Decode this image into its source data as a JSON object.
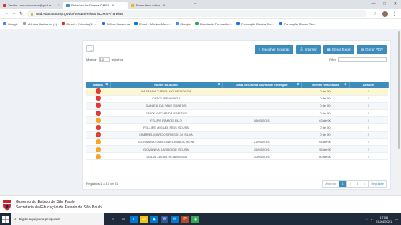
{
  "tabs": [
    {
      "label": "Tarefa - rosanasaraiva@prof.edu.com",
      "color": "#d93025",
      "active": false
    },
    {
      "label": "Relatório de Tarefas CMSP",
      "color": "#3c8dbc",
      "active": true
    },
    {
      "label": "Formulário editor",
      "color": "#f4b400",
      "active": false
    }
  ],
  "window_controls": [
    "—",
    "□",
    "✕"
  ],
  "address": {
    "url": "sed.educacao.sp.gov.br/SedBI/RelatorioCMSP/Tarefas"
  },
  "bookmarks": [
    {
      "label": "Google",
      "color": "#4285f4"
    },
    {
      "label": "Mônica Harikamp (1)",
      "color": "#9e9e9e"
    },
    {
      "label": "Gmail - Entrada (1) ...",
      "color": "#d93025"
    },
    {
      "label": "Sêltica Mostema",
      "color": "#1a73e8"
    },
    {
      "label": "Email - Mônica Maru...",
      "color": "#0078d4"
    },
    {
      "label": "Google",
      "color": "#4285f4"
    },
    {
      "label": "Escola da Formação...",
      "color": "#34a853"
    },
    {
      "label": "Formação Básica Tec...",
      "color": "#1a73e8"
    },
    {
      "label": "Formação Básica Tec...",
      "color": "#1a73e8"
    }
  ],
  "toolbar": {
    "expand_icon": "⛶",
    "buttons": [
      {
        "label": "Escolher Colunas",
        "icon": "≡"
      },
      {
        "label": "Imprimir",
        "icon": "⎙"
      },
      {
        "label": "Gerar Excel",
        "icon": "▦"
      },
      {
        "label": "Gerar PDF",
        "icon": "▤"
      }
    ]
  },
  "length": {
    "prefix": "Mostrar",
    "value": "10",
    "suffix": "registros"
  },
  "filter": {
    "label": "Filtro",
    "value": ""
  },
  "table": {
    "headers": [
      "Status",
      "Nome do Aluno",
      "Data de Última Atividade Entregue",
      "Tarefas Realizadas",
      "Detalhe"
    ],
    "rows": [
      {
        "status": "#e53935",
        "name": "BARBARA CARVALHO DE SOUZA",
        "date": "",
        "done": "0 de 90"
      },
      {
        "status": "#e53935",
        "name": "CAROLINE HONDA",
        "date": "",
        "done": "0 de 90"
      },
      {
        "status": "#e53935",
        "name": "DANIELI DA PAAS SANTOS",
        "date": "",
        "done": "0 de 90"
      },
      {
        "status": "#e53935",
        "name": "ERICK OSCAR DE FREITAS",
        "date": "",
        "done": "0 de 90"
      },
      {
        "status": "#f5a623",
        "name": "FELIPE RAMOS FILO",
        "date": "08/03/2021",
        "done": "63 de 90"
      },
      {
        "status": "#e53935",
        "name": "FELLIPE MIGUEL REIS SOUSA",
        "date": "",
        "done": "0 de 90"
      },
      {
        "status": "#e53935",
        "name": "GABRIEL MARCOS ROSSI DA SILVA",
        "date": "",
        "done": "0 de 90"
      },
      {
        "status": "#f5a623",
        "name": "GIOVANNA CAROLINE LIMA DA SILVA",
        "date": "21/04/2021",
        "done": "64 de 90"
      },
      {
        "status": "#f5a623",
        "name": "GIOVANNA SATIRO DE SOUSA",
        "date": "25/03/2021",
        "done": "55 de 90"
      },
      {
        "status": "#f5a623",
        "name": "GIULIA CALASTRI ALMEIDA",
        "date": "20/04/2021",
        "done": "60 de 90"
      }
    ]
  },
  "info": "Registros 1 a 10 de 31",
  "pager": [
    "Anterior",
    "1",
    "2",
    "3",
    "4",
    "Seguinte"
  ],
  "pager_current": "1",
  "footer": {
    "line1": "Governo do Estado de São Paulo",
    "line2": "Secretaria da Educação do Estado de São Paulo"
  },
  "taskbar": {
    "search_placeholder": "Digite aqui para pesquisar",
    "apps": [
      {
        "icon": "○",
        "bg": "transparent"
      },
      {
        "icon": "▭",
        "bg": "transparent"
      },
      {
        "icon": "e",
        "bg": "#0078d4"
      },
      {
        "icon": "▰",
        "bg": "#f0c419"
      },
      {
        "icon": "◆",
        "bg": "#0078d4"
      },
      {
        "icon": "W",
        "bg": "#2b579a"
      },
      {
        "icon": "✉",
        "bg": "#0078d4"
      },
      {
        "icon": "P",
        "bg": "#b7472a"
      },
      {
        "icon": "◉",
        "bg": "#34a853"
      }
    ],
    "time": "17:06",
    "date": "21/04/2021"
  }
}
